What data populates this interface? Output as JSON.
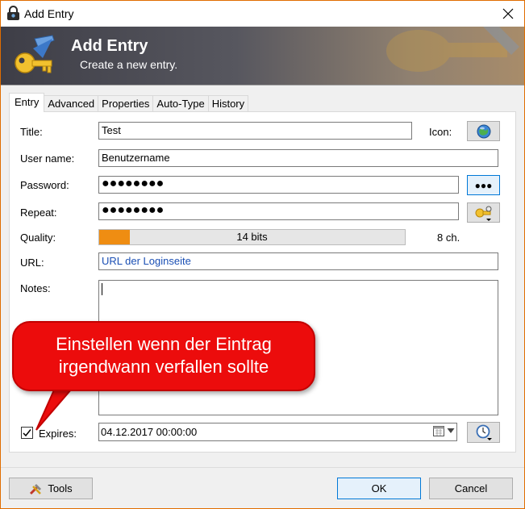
{
  "window": {
    "title": "Add Entry"
  },
  "banner": {
    "title": "Add Entry",
    "subtitle": "Create a new entry."
  },
  "tabs": [
    {
      "label": "Entry",
      "active": true
    },
    {
      "label": "Advanced",
      "active": false
    },
    {
      "label": "Properties",
      "active": false
    },
    {
      "label": "Auto-Type",
      "active": false
    },
    {
      "label": "History",
      "active": false
    }
  ],
  "form": {
    "title_label": "Title:",
    "title_value": "Test",
    "icon_label": "Icon:",
    "username_label": "User name:",
    "username_value": "Benutzername",
    "password_label": "Password:",
    "password_value": "●●●●●●●●",
    "repeat_label": "Repeat:",
    "repeat_value": "●●●●●●●●",
    "show_password_button": "●●●",
    "quality_label": "Quality:",
    "quality_text": "14 bits",
    "quality_fraction": 0.1,
    "length_text": "8 ch.",
    "url_label": "URL:",
    "url_value": "URL der Loginseite",
    "notes_label": "Notes:",
    "notes_value": "",
    "expires_label": "Expires:",
    "expires_checked": true,
    "expires_value": "04.12.2017 00:00:00"
  },
  "callout": {
    "line1": "Einstellen wenn der Eintrag",
    "line2": "irgendwann verfallen sollte"
  },
  "footer": {
    "tools_label": "Tools",
    "ok_label": "OK",
    "cancel_label": "Cancel"
  },
  "colors": {
    "accent": "#0078d7",
    "quality_fill": "#ef8d12",
    "callout": "#ec0c0c",
    "url_text": "#1a4fb4"
  },
  "icons": {
    "app": "lock-icon",
    "close": "close-icon",
    "banner": "key-pen-icon",
    "entry_icon": "globe-icon",
    "generate": "key-gear-icon",
    "calendar": "calendar-icon",
    "dropdown": "chevron-down-icon",
    "expiry_preset": "clock-icon",
    "tools": "tools-icon"
  }
}
